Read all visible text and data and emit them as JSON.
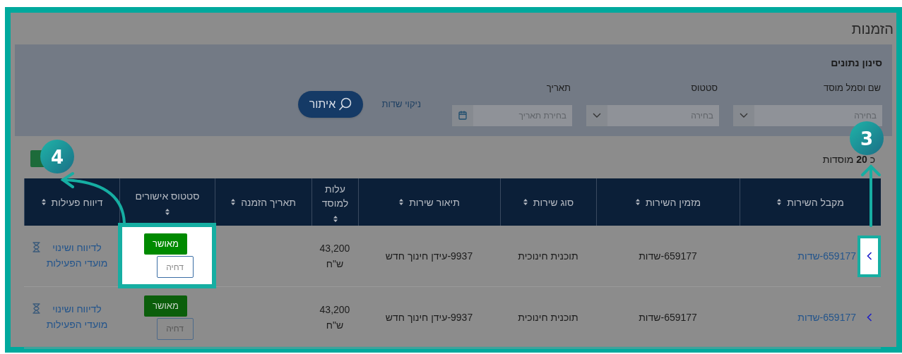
{
  "page_title": "הזמנות",
  "filter": {
    "title": "סינון נתונים",
    "fields": [
      {
        "kind": "select",
        "label": "שם וסמל מוסד",
        "placeholder": "בחירה"
      },
      {
        "kind": "select",
        "label": "סטטוס",
        "placeholder": "בחירה"
      },
      {
        "kind": "date",
        "label": "תאריך",
        "placeholder": "בחירת תאריך"
      }
    ],
    "clear_link": "ניקוי שדות",
    "search_button": "איתור"
  },
  "count_text": "כ **20** מוסדות",
  "table": {
    "columns": [
      "מקבל השירות",
      "מזמין השירות",
      "סוג שירות",
      "תיאור שירות",
      "עלות למוסד",
      "תאריך הזמנה",
      "סטטוס אישורים",
      "דיווח פעילות"
    ],
    "rows": [
      {
        "spotlight": true,
        "recipient": "659177-שדות",
        "orderer": "659177-שדות",
        "service_type": "תוכנית חינוכית",
        "description": "9937-עידן חינוך חדש",
        "cost": "43,200 ש\"ח",
        "approve_button": "מאושר",
        "reject_button": "דחיה",
        "report_link": "לדיווח ושינוי מועדי הפעילות"
      },
      {
        "spotlight": false,
        "recipient": "659177-שדות",
        "orderer": "659177-שדות",
        "service_type": "תוכנית חינוכית",
        "description": "9937-עידן חינוך חדש",
        "cost": "43,200 ש\"ח",
        "approve_button": "מאושר",
        "reject_button": "דחיה",
        "report_link": "לדיווח ושינוי מועדי הפעילות"
      }
    ]
  },
  "annotations": [
    {
      "number": "3"
    },
    {
      "number": "4"
    }
  ]
}
